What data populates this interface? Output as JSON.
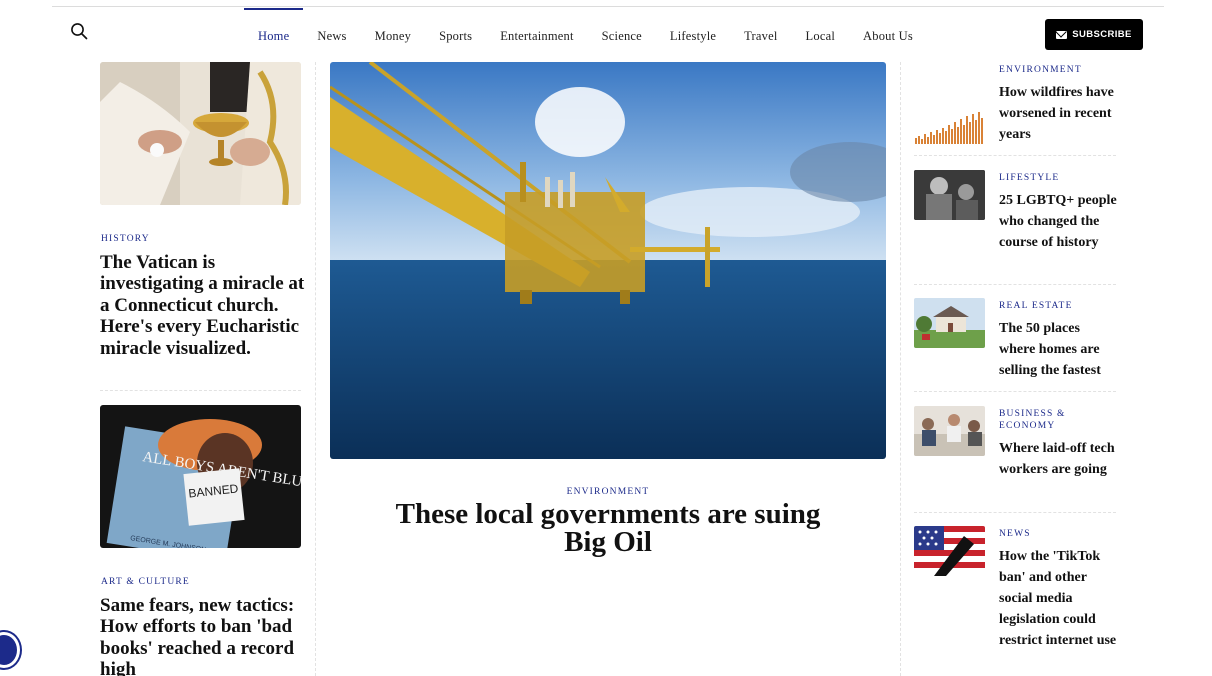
{
  "header": {
    "nav": [
      "Home",
      "News",
      "Money",
      "Sports",
      "Entertainment",
      "Science",
      "Lifestyle",
      "Travel",
      "Local",
      "About Us"
    ],
    "active": "Home",
    "subscribe_label": "SUBSCRIBE"
  },
  "left": {
    "story1": {
      "kicker": "HISTORY",
      "headline": "The Vatican is investigating a miracle at a Connecticut church. Here's every Eucharistic miracle visualized."
    },
    "story2": {
      "kicker": "ART & CULTURE",
      "headline": "Same fears, new tactics: How efforts to ban 'bad books' reached a record high"
    },
    "book_cover_text": "ALL BOYS AREN'T BLUE",
    "book_author": "GEORGE M. JOHNSON",
    "banned_sign": "BANNED"
  },
  "center": {
    "kicker": "ENVIRONMENT",
    "headline": "These local governments are suing Big Oil"
  },
  "right": {
    "items": [
      {
        "kicker": "ENVIRONMENT",
        "title": "How wildfires have worsened in recent years"
      },
      {
        "kicker": "LIFESTYLE",
        "title": "25 LGBTQ+ people who changed the course of history"
      },
      {
        "kicker": "REAL ESTATE",
        "title": "The 50 places where homes are selling the fastest"
      },
      {
        "kicker": "BUSINESS & ECONOMY",
        "title": "Where laid-off tech workers are going"
      },
      {
        "kicker": "NEWS",
        "title": "How the 'TikTok ban' and other social media legislation could restrict internet use"
      }
    ]
  },
  "colors": {
    "accent": "#1c2a8a",
    "subscribe_bg": "#000000"
  },
  "icons": {
    "search": "search-icon",
    "mail": "mail-icon",
    "accessibility": "accessibility-icon"
  }
}
